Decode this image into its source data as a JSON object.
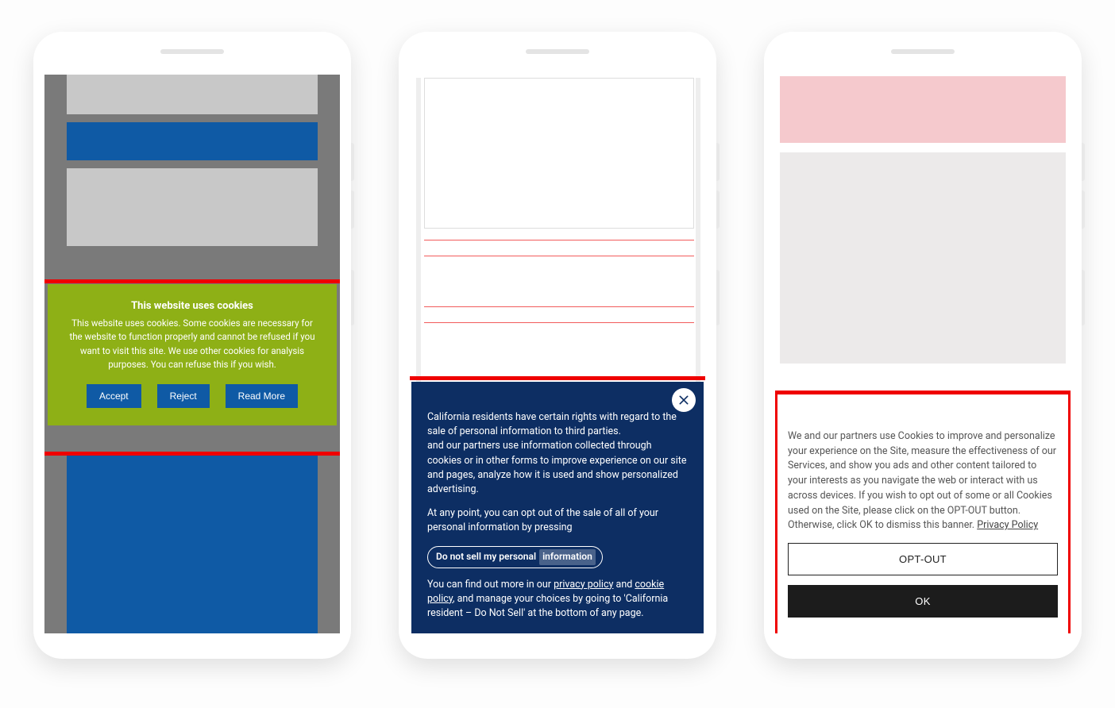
{
  "phone1": {
    "cookie": {
      "title": "This website uses cookies",
      "body": "This website uses cookies. Some cookies are necessary for the website to function properly and cannot be refused if you want to visit this site. We use other cookies for analysis purposes. You can refuse this if you wish.",
      "accept": "Accept",
      "reject": "Reject",
      "read_more": "Read More"
    }
  },
  "phone2": {
    "cookie": {
      "para1_a": "California residents have certain rights with regard to the sale of personal information to third parties.",
      "para1_b": "and our partners use information collected through cookies or in other forms to improve experience on our site and pages, analyze how it is used and show personalized advertising.",
      "para2": "At any point, you can opt out of the sale of all of your personal information by pressing",
      "dns_prefix": "Do not sell my personal",
      "dns_info": "information",
      "para3_a": "You can find out more in our ",
      "privacy": "privacy policy",
      "and": " and ",
      "cookie_policy": "cookie policy",
      "para3_b": ", and manage your choices by going to 'California resident – Do Not Sell' at the bottom of any page."
    }
  },
  "phone3": {
    "cookie": {
      "body": "We and our partners use Cookies to improve and personalize your experience on the Site, measure the effectiveness of our Services, and show you ads and other content tailored to your interests as you navigate the web or interact with us across devices. If you wish to opt out of some or all Cookies used on the Site, please click on the OPT-OUT button. Otherwise, click OK to dismiss this banner. ",
      "privacy": "Privacy Policy",
      "opt_out": "OPT-OUT",
      "ok": "OK"
    }
  }
}
